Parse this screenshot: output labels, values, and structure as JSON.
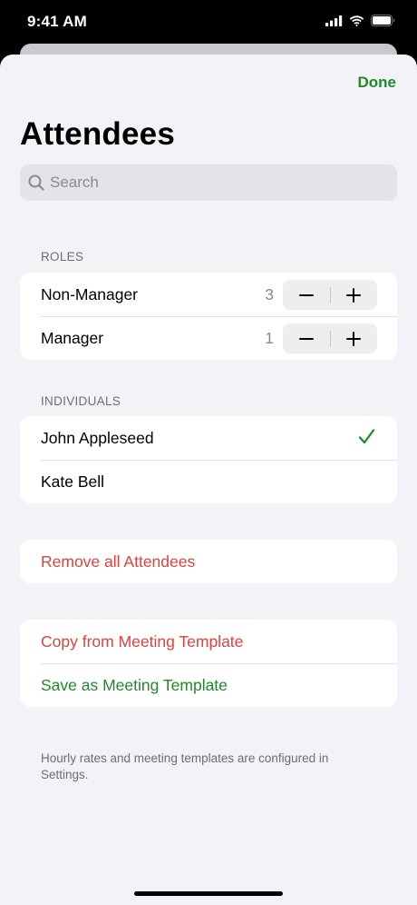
{
  "status_bar": {
    "time": "9:41 AM"
  },
  "header": {
    "done_label": "Done",
    "title": "Attendees"
  },
  "search": {
    "placeholder": "Search",
    "value": ""
  },
  "roles": {
    "header": "ROLES",
    "items": [
      {
        "label": "Non-Manager",
        "count": "3"
      },
      {
        "label": "Manager",
        "count": "1"
      }
    ]
  },
  "individuals": {
    "header": "INDIVIDUALS",
    "items": [
      {
        "label": "John Appleseed",
        "selected": true
      },
      {
        "label": "Kate Bell",
        "selected": false
      }
    ]
  },
  "actions": {
    "remove_all": "Remove all Attendees",
    "copy_template": "Copy from Meeting Template",
    "save_template": "Save as Meeting Template"
  },
  "footer": {
    "note": "Hourly rates and meeting templates are configured in Settings."
  },
  "colors": {
    "accent_green": "#1f8a2a",
    "destructive_red": "#e0413c",
    "background": "#f2f2f7"
  },
  "icons": {
    "search": "magnifying-glass-icon",
    "check": "checkmark-icon",
    "minus": "minus-icon",
    "plus": "plus-icon"
  }
}
